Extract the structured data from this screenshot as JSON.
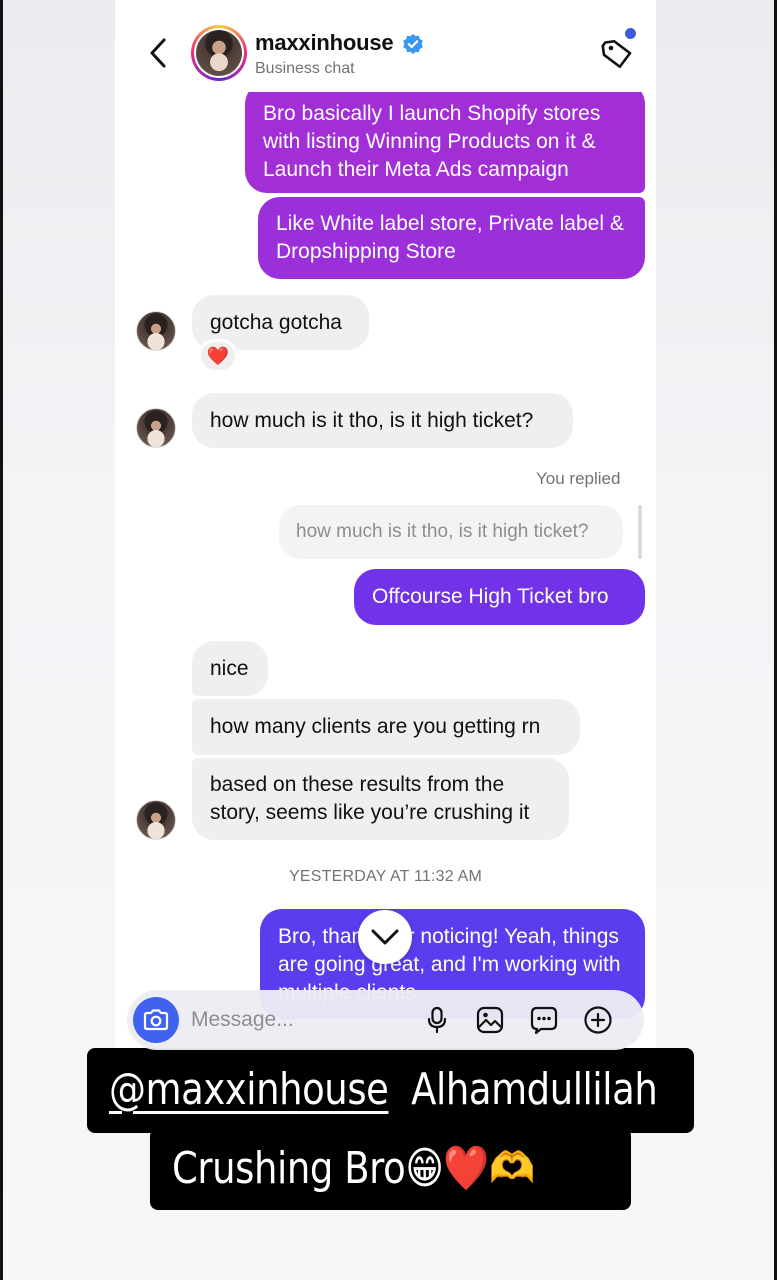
{
  "header": {
    "username": "maxxinhouse",
    "subtitle": "Business chat"
  },
  "messages": {
    "out_1": "Bro basically I launch Shopify stores with listing Winning Products on it & Launch their Meta Ads campaign",
    "out_2": "Like White label store, Private label & Dropshipping Store",
    "in_1": "gotcha gotcha",
    "in_1_reaction": "❤️",
    "in_2": "how much is it tho, is it high ticket?",
    "replied_label": "You replied",
    "quoted": "how much is it tho, is it high ticket?",
    "out_3": "Offcourse High Ticket bro",
    "in_3": "nice",
    "in_4": "how many clients are you getting rn",
    "in_5": "based on these results from the story, seems like you’re crushing it",
    "timestamp": "YESTERDAY AT 11:32 AM",
    "out_4": "Bro, thanks for noticing! Yeah, things are going great, and I'm working with multiple clients"
  },
  "composer": {
    "placeholder": "Message..."
  },
  "caption": {
    "line1_mention": "@maxxinhouse",
    "line1_text": "Alhamdullilah",
    "line2": "Crushing Bro😁❤️🫶"
  },
  "colors": {
    "out_purple": "#a22fd6",
    "out_violet": "#7132e8",
    "out_blue": "#5b3df0",
    "accent_blue": "#3f63f0"
  },
  "icons": [
    "back-icon",
    "verified-icon",
    "label-icon",
    "chevron-down-icon",
    "camera-icon",
    "microphone-icon",
    "gallery-icon",
    "sticker-icon",
    "add-icon"
  ]
}
